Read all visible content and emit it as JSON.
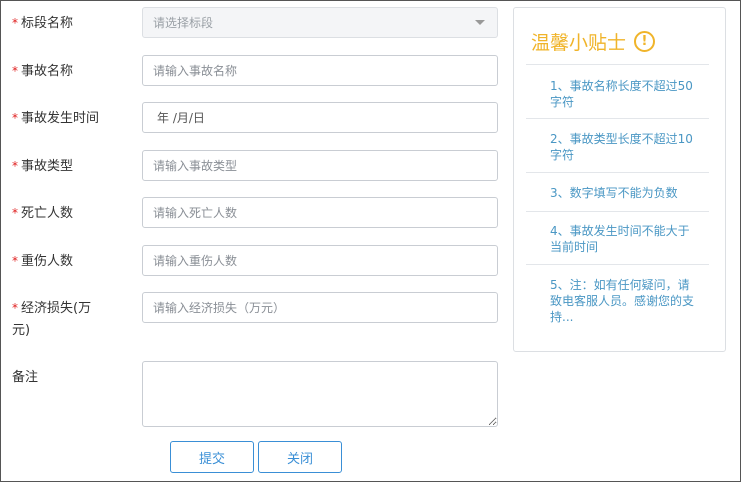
{
  "form": {
    "section": {
      "label": "标段名称",
      "placeholder": "请选择标段"
    },
    "accident_name": {
      "label": "事故名称",
      "placeholder": "请输入事故名称"
    },
    "accident_time": {
      "label": "事故发生时间",
      "value": "年 /月/日"
    },
    "accident_type": {
      "label": "事故类型",
      "placeholder": "请输入事故类型"
    },
    "deaths": {
      "label": "死亡人数",
      "placeholder": "请输入死亡人数"
    },
    "injuries": {
      "label": "重伤人数",
      "placeholder": "请输入重伤人数"
    },
    "loss": {
      "label_line1": "经济损失(万",
      "label_line2": "元)",
      "placeholder": "请输入经济损失（万元）"
    },
    "remark": {
      "label": "备注",
      "value": ""
    },
    "required_mark": "*"
  },
  "buttons": {
    "submit": "提交",
    "close": "关闭"
  },
  "tips": {
    "title": "温馨小贴士",
    "icon": "exclamation-circle-icon",
    "items": [
      "1、事故名称长度不超过50字符",
      "2、事故类型长度不超过10字符",
      "3、数字填写不能为负数",
      "4、事故发生时间不能大于当前时间",
      "5、注：如有任何疑问，请致电客服人员。感谢您的支持..."
    ]
  },
  "colors": {
    "required": "#e02020",
    "accent": "#3a8fd6",
    "tip_title": "#f0b42a",
    "tip_text": "#4a97c4"
  }
}
